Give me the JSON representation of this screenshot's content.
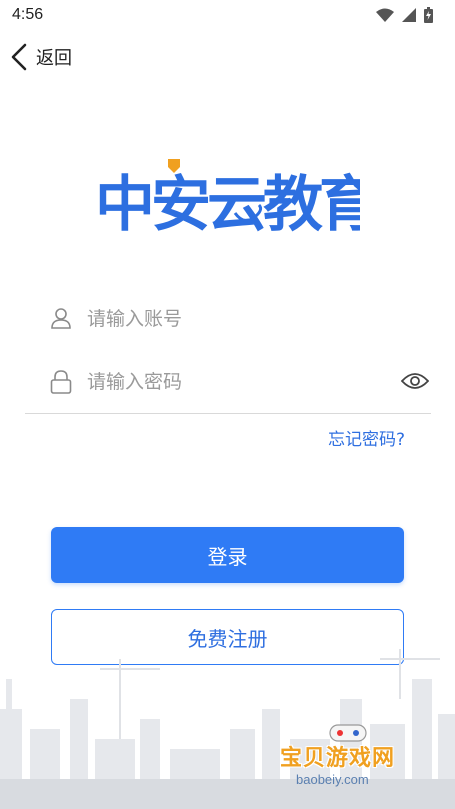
{
  "status_bar": {
    "time": "4:56"
  },
  "nav": {
    "back_label": "返回"
  },
  "logo": {
    "text": "中安云教育"
  },
  "form": {
    "account_placeholder": "请输入账号",
    "password_placeholder": "请输入密码",
    "forgot_label": "忘记密码?"
  },
  "buttons": {
    "login_label": "登录",
    "register_label": "免费注册"
  },
  "watermark": {
    "title": "宝贝游戏网",
    "url": "baobeiy.com"
  },
  "colors": {
    "primary": "#2f7bf5",
    "logo_blue": "#2d6fe0",
    "accent_orange": "#f0a020"
  }
}
